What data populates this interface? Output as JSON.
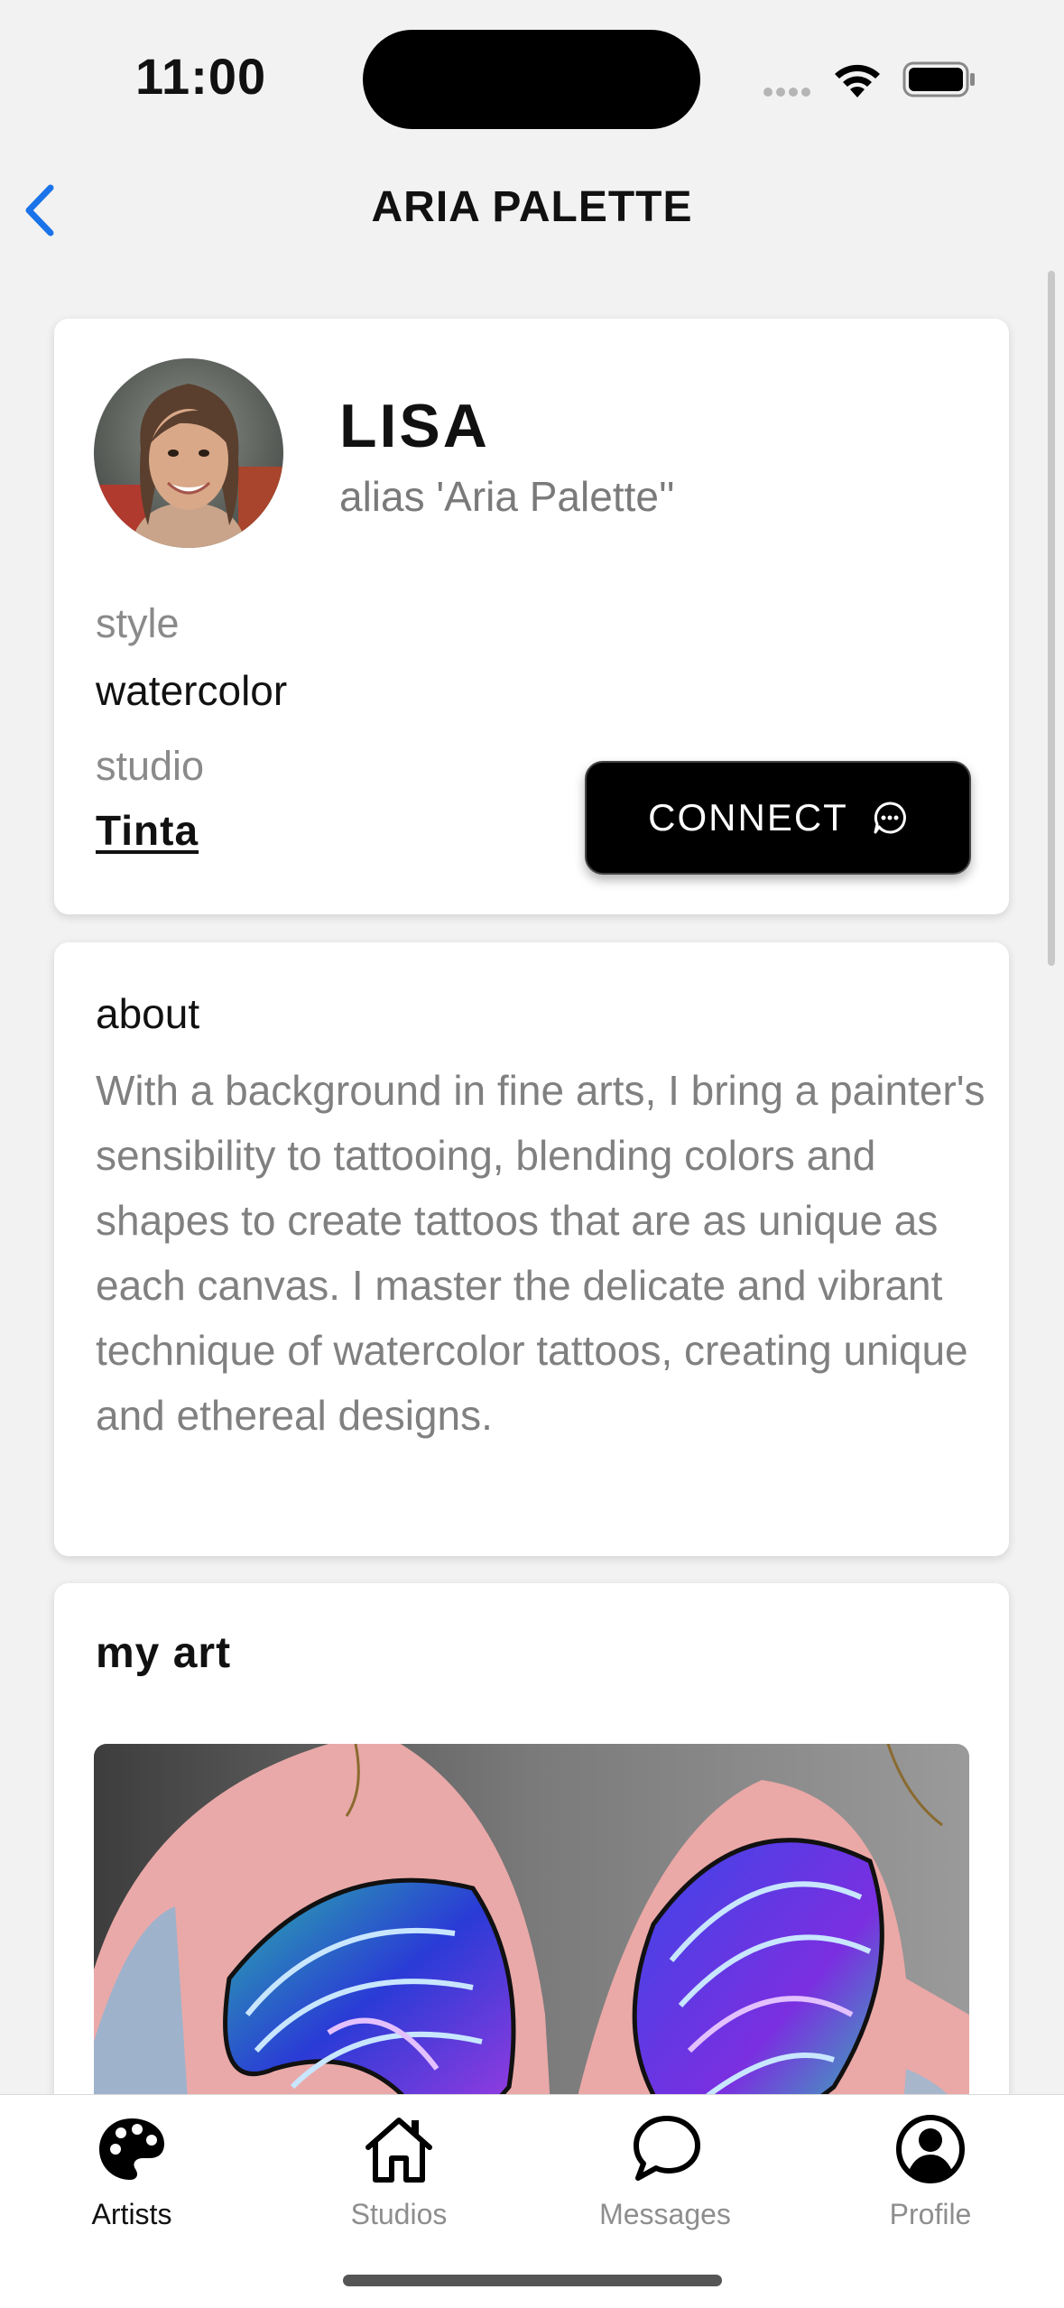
{
  "status": {
    "time": "11:00"
  },
  "nav": {
    "title": "ARIA PALETTE"
  },
  "artist": {
    "name": "LISA",
    "alias": "alias 'Aria Palette''",
    "style_label": "style",
    "style_value": "watercolor",
    "studio_label": "studio",
    "studio_value": "Tinta",
    "connect_label": "CONNECT"
  },
  "about": {
    "title": "about",
    "text": "With a background in fine arts, I bring a painter's sensibility to tattooing, blending colors and shapes to create tattoos that are as unique as each canvas. I master the delicate and vibrant technique of watercolor tattoos, creating unique and ethereal designs."
  },
  "art": {
    "title": "my art"
  },
  "tabs": [
    {
      "label": "Artists",
      "icon": "palette-icon"
    },
    {
      "label": "Studios",
      "icon": "house-icon"
    },
    {
      "label": "Messages",
      "icon": "chat-bubble-icon"
    },
    {
      "label": "Profile",
      "icon": "person-circle-icon"
    }
  ],
  "colors": {
    "accent": "#1a73e8",
    "button": "#000000"
  }
}
